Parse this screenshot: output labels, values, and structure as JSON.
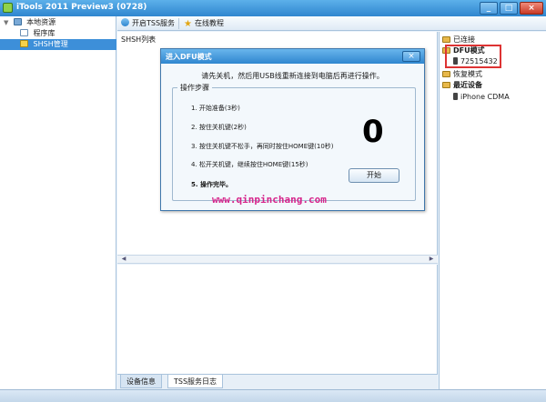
{
  "window": {
    "title": "iTools 2011 Preview3 (0728)",
    "minimize": "_",
    "maximize": "□",
    "close": "×"
  },
  "sidebar": {
    "items": [
      {
        "label": "本地资源",
        "expander": "▼",
        "icon": "computer-icon"
      },
      {
        "label": "程序库",
        "icon": "app-library-icon"
      },
      {
        "label": "SHSH管理",
        "icon": "shsh-icon",
        "selected": true
      }
    ]
  },
  "toolbar": {
    "tss_label": "开启TSS服务",
    "tutorial_label": "在线教程"
  },
  "main": {
    "title": "SHSH列表",
    "scroll_left": "◀",
    "scroll_right": "▶"
  },
  "bottom_tabs": [
    {
      "label": "设备信息",
      "active": false
    },
    {
      "label": "TSS服务日志",
      "active": true
    }
  ],
  "right_panel": {
    "connected": "已连接",
    "dfu_mode": "DFU模式",
    "dfu_device": "72515432",
    "recovery_mode": "恢复模式",
    "recent_devices": "最近设备",
    "recent_device": "iPhone CDMA"
  },
  "dialog": {
    "title": "进入DFU模式",
    "close": "×",
    "instruction": "请先关机，然后用USB线重新连接到电脑后再进行操作。",
    "steps_legend": "操作步骤",
    "steps": [
      "1. 开始准备(3秒)",
      "2. 按住关机键(2秒)",
      "3. 按住关机键不松手，再同时按住HOME键(10秒)",
      "4. 松开关机键，继续按住HOME键(15秒)",
      "5. 操作完毕。"
    ],
    "countdown": "0",
    "start_button": "开始"
  },
  "watermark": "www.qinpinchang.com",
  "colors": {
    "accent": "#2f86cf",
    "selection": "#3d8fd9",
    "highlight_border": "#dd3333",
    "watermark": "#d6238a"
  }
}
